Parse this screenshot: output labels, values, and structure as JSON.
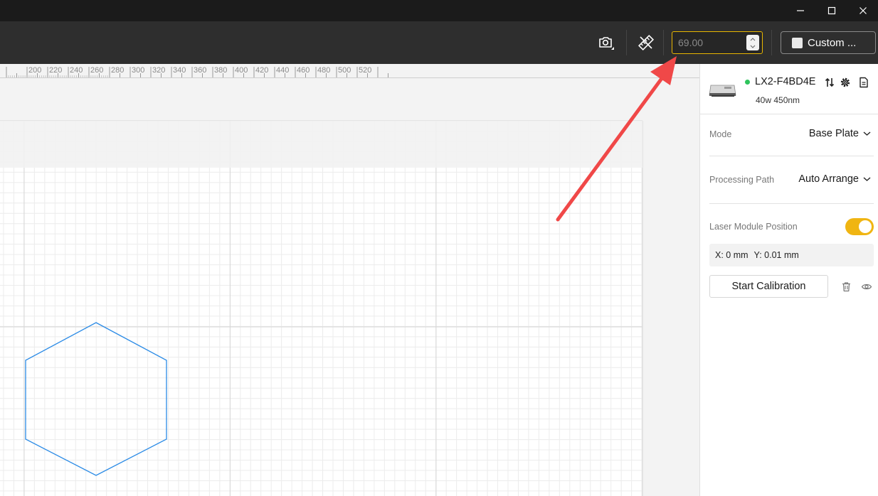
{
  "window": {
    "minimize_icon": "minimize-icon",
    "maximize_icon": "maximize-icon",
    "close_icon": "close-icon"
  },
  "toolbar": {
    "camera_icon": "camera-icon",
    "measure_icon": "measure-ruler-icon",
    "speed_value": "69.00",
    "custom_label": "Custom ...",
    "accent_color": "#e8b600"
  },
  "ruler": {
    "ticks": [
      "200",
      "220",
      "240",
      "260",
      "280",
      "300",
      "320",
      "340",
      "360",
      "380",
      "400",
      "420",
      "440",
      "460",
      "480",
      "500",
      "520"
    ]
  },
  "canvas": {
    "shape": "hexagon",
    "shape_color": "#2b8be6"
  },
  "device": {
    "name": "LX2-F4BD4E",
    "spec": "40w 450nm",
    "status_color": "#2ec45c",
    "icons": [
      "swap-icon",
      "settings-icon",
      "document-icon"
    ]
  },
  "settings": {
    "mode_label": "Mode",
    "mode_value": "Base Plate",
    "path_label": "Processing Path",
    "path_value": "Auto Arrange",
    "laser_label": "Laser Module Position",
    "laser_toggle_on": true,
    "coord_x": "X: 0 mm",
    "coord_y": "Y: 0.01 mm",
    "calibration_label": "Start Calibration"
  },
  "annotation": {
    "arrow_color": "#f04848"
  }
}
